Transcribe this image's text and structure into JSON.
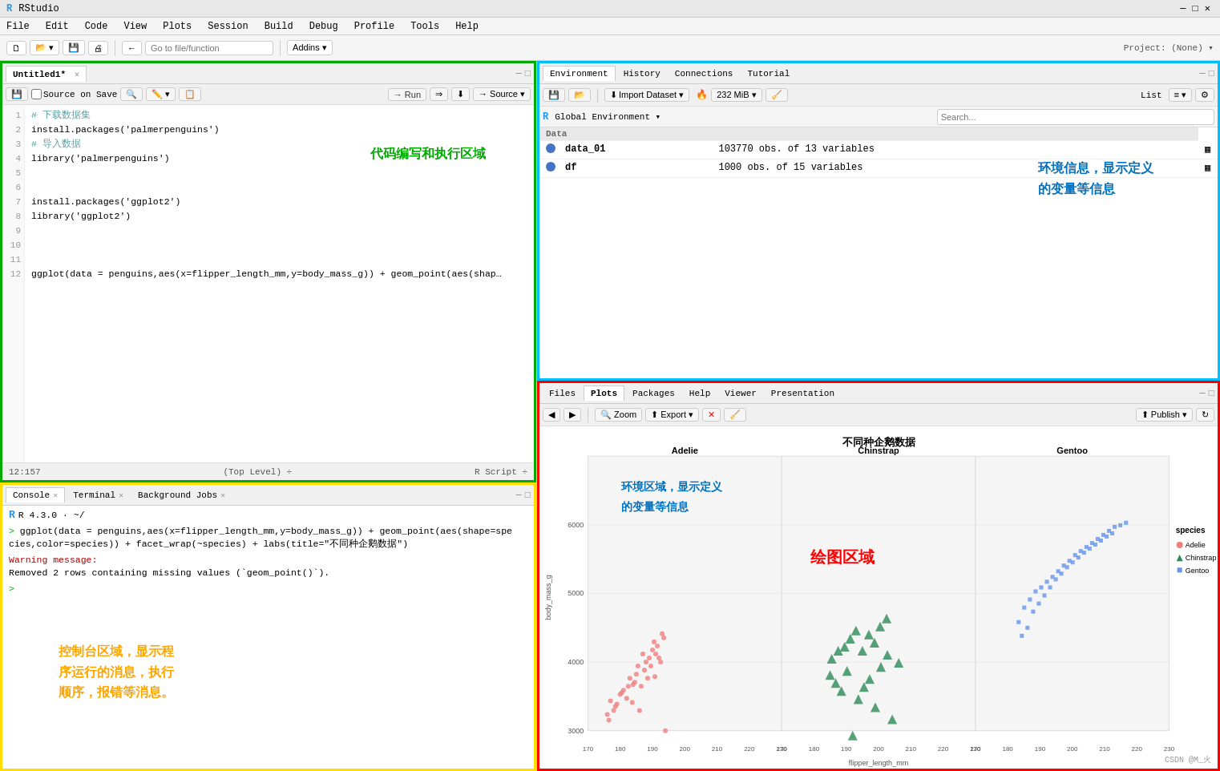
{
  "titlebar": {
    "title": "RStudio"
  },
  "menubar": {
    "items": [
      "File",
      "Edit",
      "Code",
      "View",
      "Plots",
      "Session",
      "Build",
      "Debug",
      "Profile",
      "Tools",
      "Help"
    ]
  },
  "toolbar": {
    "new_btn": "🗋",
    "open_btn": "📂",
    "save_btn": "💾",
    "print_btn": "🖨",
    "go_to_file": "Go to file/function",
    "addins": "Addins",
    "project": "Project: (None)"
  },
  "editor": {
    "tab_name": "Untitled1*",
    "source_on_save": "Source on Save",
    "run_btn": "→ Run",
    "source_btn": "→ Source",
    "annotation": "代码编写和执行区域",
    "lines": [
      {
        "num": 1,
        "text": "# 下载数据集",
        "type": "comment"
      },
      {
        "num": 2,
        "text": "install.packages('palmerpenguins')",
        "type": "normal"
      },
      {
        "num": 3,
        "text": "# 导入数据",
        "type": "comment"
      },
      {
        "num": 4,
        "text": "library('palmerpenguins')",
        "type": "normal"
      },
      {
        "num": 5,
        "text": "",
        "type": "normal"
      },
      {
        "num": 6,
        "text": "",
        "type": "normal"
      },
      {
        "num": 7,
        "text": "install.packages('ggplot2')",
        "type": "normal"
      },
      {
        "num": 8,
        "text": "library('ggplot2')",
        "type": "normal"
      },
      {
        "num": 9,
        "text": "",
        "type": "normal"
      },
      {
        "num": 10,
        "text": "",
        "type": "normal"
      },
      {
        "num": 11,
        "text": "",
        "type": "normal"
      },
      {
        "num": 12,
        "text": "ggplot(data = penguins,aes(x=flipper_length_mm,y=body_mass_g)) + geom_point(aes(shap…",
        "type": "normal"
      }
    ],
    "status_left": "12:157",
    "status_mid": "(Top Level) ÷",
    "status_right": "R Script ÷"
  },
  "console": {
    "tabs": [
      {
        "label": "Console",
        "active": true
      },
      {
        "label": "Terminal",
        "active": false
      },
      {
        "label": "Background Jobs",
        "active": false
      }
    ],
    "r_version": "R 4.3.0 · ~/",
    "lines": [
      {
        "type": "prompt",
        "text": "> ggplot(data = penguins,aes(x=flipper_length_mm,y=body_mass_g)) + geom_point(aes(shape=spe\ncies,color=species)) + facet_wrap(~species) + labs(title=\"不同种企鹅数据\")"
      },
      {
        "type": "warn",
        "text": "Warning message:"
      },
      {
        "type": "normal",
        "text": "Removed 2 rows containing missing values (`geom_point()`)."
      },
      {
        "type": "prompt_only",
        "text": "> "
      }
    ],
    "annotation": "控制台区域，显示程\n序运行的消息，执行\n顺序，报错等消息。"
  },
  "environment": {
    "tabs": [
      "Environment",
      "History",
      "Connections",
      "Tutorial"
    ],
    "active_tab": "Environment",
    "toolbar": {
      "import_dataset": "Import Dataset",
      "memory": "232 MiB",
      "list_view": "List"
    },
    "global_env": "Global Environment",
    "section_header": "Data",
    "variables": [
      {
        "name": "data_01",
        "value": "103770 obs. of  13 variables"
      },
      {
        "name": "df",
        "value": "1000 obs. of  15 variables"
      }
    ],
    "annotation_line1": "环境信息，显示定义",
    "annotation_line2": "的变量等信息"
  },
  "files": {
    "tabs": [
      "Files",
      "Plots",
      "Packages",
      "Help",
      "Viewer",
      "Presentation"
    ],
    "active_tab": "Plots",
    "toolbar": {
      "zoom": "Zoom",
      "export": "Export",
      "publish": "Publish"
    }
  },
  "plot": {
    "title": "不同种企鹅数据",
    "facets": [
      "Adelie",
      "Chinstrap",
      "Gentoo"
    ],
    "x_label": "flipper_length_mm",
    "y_label": "body_mass_g",
    "x_ticks": [
      "170",
      "180",
      "190",
      "200",
      "210",
      "220",
      "230",
      "170",
      "180",
      "190",
      "200",
      "210",
      "220",
      "230",
      "170",
      "180",
      "190",
      "200",
      "210",
      "220",
      "230"
    ],
    "y_ticks": [
      "3000",
      "4000",
      "5000",
      "6000"
    ],
    "legend_title": "species",
    "legend_items": [
      {
        "label": "Adelie",
        "color": "#f08080",
        "shape": "circle"
      },
      {
        "label": "Chinstrap",
        "color": "#2e8b57",
        "shape": "triangle"
      },
      {
        "label": "Gentoo",
        "color": "#6495ed",
        "shape": "square"
      }
    ],
    "annotation": "绘图区域",
    "annotation2_line1": "环境区域，显示定义",
    "annotation2_line2": "的变量等信息"
  },
  "watermark": "CSDN @M_火"
}
